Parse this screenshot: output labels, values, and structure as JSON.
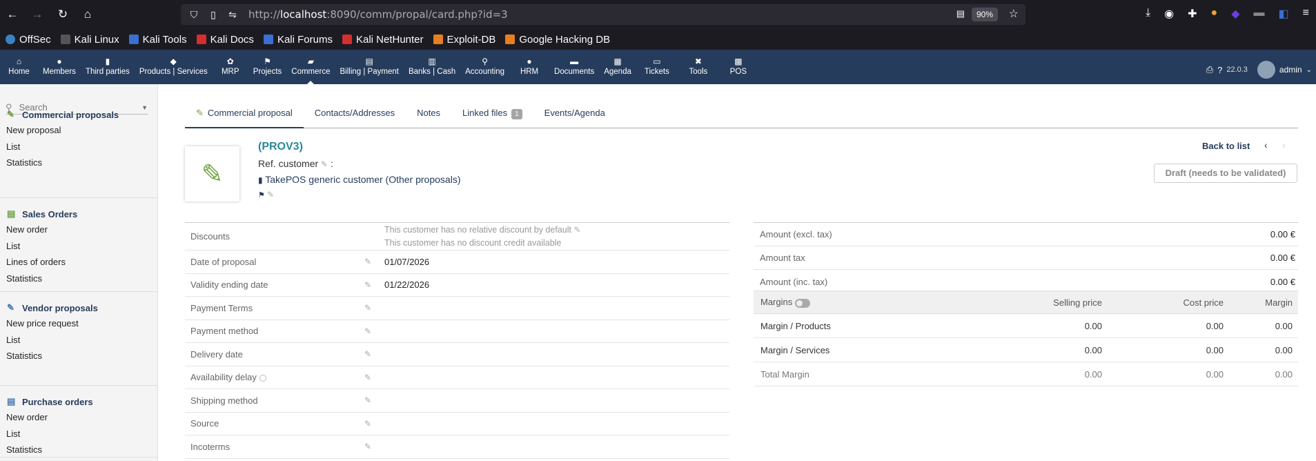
{
  "browser": {
    "url_prefix": "http://",
    "url_host": "localhost",
    "url_rest": ":8090/comm/propal/card.php?id=3",
    "zoom": "90%"
  },
  "bookmarks": [
    {
      "label": "OffSec",
      "color": "#3b82c4"
    },
    {
      "label": "Kali Linux",
      "color": "#1c1b22"
    },
    {
      "label": "Kali Tools",
      "color": "#3b6fd0"
    },
    {
      "label": "Kali Docs",
      "color": "#d32f2f"
    },
    {
      "label": "Kali Forums",
      "color": "#3b6fd0"
    },
    {
      "label": "Kali NetHunter",
      "color": "#d32f2f"
    },
    {
      "label": "Exploit-DB",
      "color": "#e67e22"
    },
    {
      "label": "Google Hacking DB",
      "color": "#e67e22"
    }
  ],
  "topnav": [
    {
      "label": "Home",
      "icon": "⌂"
    },
    {
      "label": "Members",
      "icon": "●"
    },
    {
      "label": "Third parties",
      "icon": "▮"
    },
    {
      "label": "Products | Services",
      "icon": "◆"
    },
    {
      "label": "MRP",
      "icon": "✿"
    },
    {
      "label": "Projects",
      "icon": "⚑"
    },
    {
      "label": "Commerce",
      "icon": "▰",
      "active": true
    },
    {
      "label": "Billing | Payment",
      "icon": "▤"
    },
    {
      "label": "Banks | Cash",
      "icon": "▥"
    },
    {
      "label": "Accounting",
      "icon": "⚲"
    },
    {
      "label": "HRM",
      "icon": "●"
    },
    {
      "label": "Documents",
      "icon": "▬"
    },
    {
      "label": "Agenda",
      "icon": "▦"
    },
    {
      "label": "Tickets",
      "icon": "▭"
    },
    {
      "label": "Tools",
      "icon": "✖"
    },
    {
      "label": "POS",
      "icon": "▩"
    }
  ],
  "topbar_right": {
    "version": "22.0.3",
    "user": "admin"
  },
  "leftmenu": {
    "search_placeholder": "Search",
    "sections": [
      {
        "title": "Commercial proposals",
        "items": [
          "New proposal",
          "List",
          "Statistics"
        ]
      },
      {
        "title": "Sales Orders",
        "items": [
          "New order",
          "List",
          "Lines of orders",
          "Statistics"
        ]
      },
      {
        "title": "Vendor proposals",
        "items": [
          "New price request",
          "List",
          "Statistics"
        ]
      },
      {
        "title": "Purchase orders",
        "items": [
          "New order",
          "List",
          "Statistics"
        ]
      }
    ]
  },
  "tabs": [
    {
      "label": "Commercial proposal",
      "active": true
    },
    {
      "label": "Contacts/Addresses"
    },
    {
      "label": "Notes"
    },
    {
      "label": "Linked files",
      "badge": "1"
    },
    {
      "label": "Events/Agenda"
    }
  ],
  "header": {
    "ref": "(PROV3)",
    "ref_customer_label": "Ref. customer",
    "ref_customer_sep": ":",
    "customer_name": "TakePOS generic customer",
    "other_proposals": "(Other proposals)",
    "back_to_list": "Back to list",
    "status": "Draft (needs to be validated)"
  },
  "fields": {
    "discounts_label": "Discounts",
    "discounts_line1": "This customer has no relative discount by default",
    "discounts_line2": "This customer has no discount credit available",
    "rows": [
      {
        "label": "Date of proposal",
        "value": "01/07/2026"
      },
      {
        "label": "Validity ending date",
        "value": "01/22/2026"
      },
      {
        "label": "Payment Terms",
        "value": ""
      },
      {
        "label": "Payment method",
        "value": ""
      },
      {
        "label": "Delivery date",
        "value": ""
      },
      {
        "label": "Availability delay",
        "value": "",
        "info": true
      },
      {
        "label": "Shipping method",
        "value": ""
      },
      {
        "label": "Source",
        "value": ""
      },
      {
        "label": "Incoterms",
        "value": ""
      }
    ]
  },
  "amounts": [
    {
      "label": "Amount (excl. tax)",
      "value": "0.00 €"
    },
    {
      "label": "Amount tax",
      "value": "0.00 €"
    },
    {
      "label": "Amount (inc. tax)",
      "value": "0.00 €"
    }
  ],
  "margins": {
    "headers": [
      "Margins",
      "Selling price",
      "Cost price",
      "Margin"
    ],
    "rows": [
      {
        "label": "Margin / Products",
        "selling": "0.00",
        "cost": "0.00",
        "margin": "0.00"
      },
      {
        "label": "Margin / Services",
        "selling": "0.00",
        "cost": "0.00",
        "margin": "0.00"
      },
      {
        "label": "Total Margin",
        "selling": "0.00",
        "cost": "0.00",
        "margin": "0.00",
        "total": true
      }
    ]
  }
}
